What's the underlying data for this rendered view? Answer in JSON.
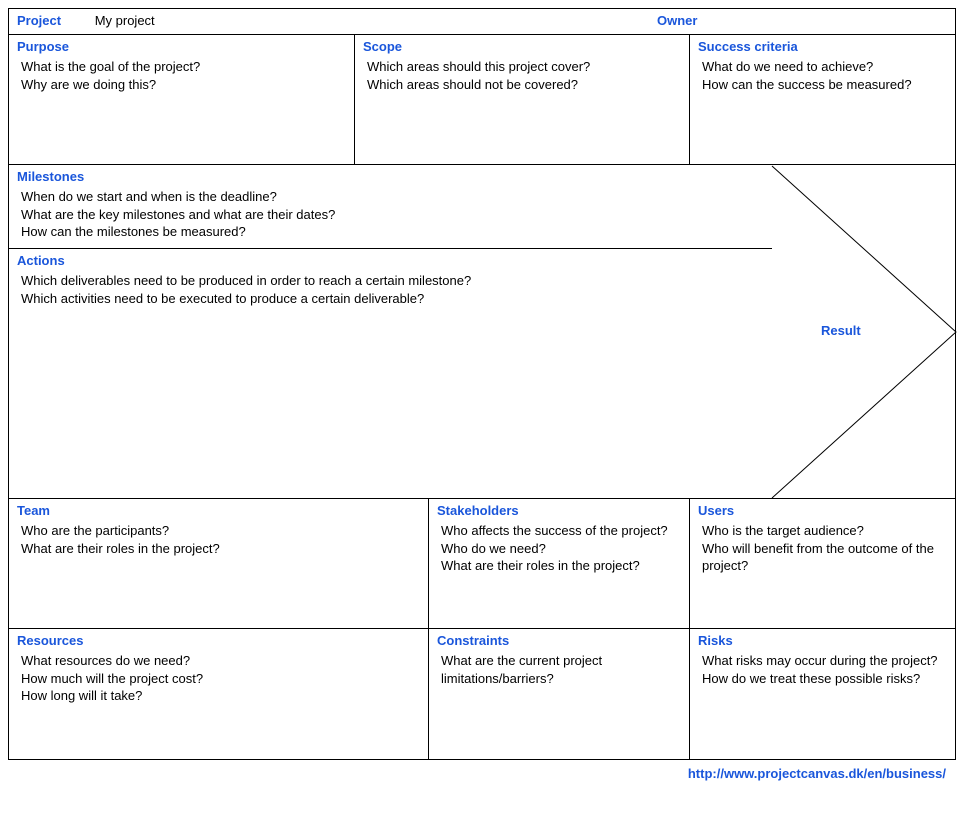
{
  "header": {
    "project_label": "Project",
    "project_value": "My project",
    "owner_label": "Owner"
  },
  "purpose": {
    "title": "Purpose",
    "q1": "What is the goal of the project?",
    "q2": "Why are we doing this?"
  },
  "scope": {
    "title": "Scope",
    "q1": "Which areas should this project cover?",
    "q2": "Which areas should not be covered?"
  },
  "success": {
    "title": "Success criteria",
    "q1": "What do we need to achieve?",
    "q2": "How can the success be measured?"
  },
  "milestones": {
    "title": "Milestones",
    "q1": "When do we start and when is the deadline?",
    "q2": "What are the key milestones and what are their dates?",
    "q3": "How can the milestones be measured?"
  },
  "actions": {
    "title": "Actions",
    "q1": "Which deliverables need to be produced in order to reach a certain milestone?",
    "q2": "Which activities need to be executed to produce a certain deliverable?"
  },
  "result": {
    "title": "Result"
  },
  "team": {
    "title": "Team",
    "q1": "Who are the participants?",
    "q2": "What are their roles in the project?"
  },
  "stakeholders": {
    "title": "Stakeholders",
    "q1": "Who affects the success of the project?",
    "q2": "Who do we need?",
    "q3": "What are their roles in the project?"
  },
  "users": {
    "title": "Users",
    "q1": "Who is the target audience?",
    "q2": "Who will benefit from the outcome of the project?"
  },
  "resources": {
    "title": "Resources",
    "q1": "What resources do we need?",
    "q2": "How much will the project cost?",
    "q3": "How long will it take?"
  },
  "constraints": {
    "title": "Constraints",
    "q1": "What are the current project limitations/barriers?"
  },
  "risks": {
    "title": "Risks",
    "q1": "What risks may occur during the project?",
    "q2": "How do we treat these possible risks?"
  },
  "footer": {
    "link": "http://www.projectcanvas.dk/en/business/"
  }
}
